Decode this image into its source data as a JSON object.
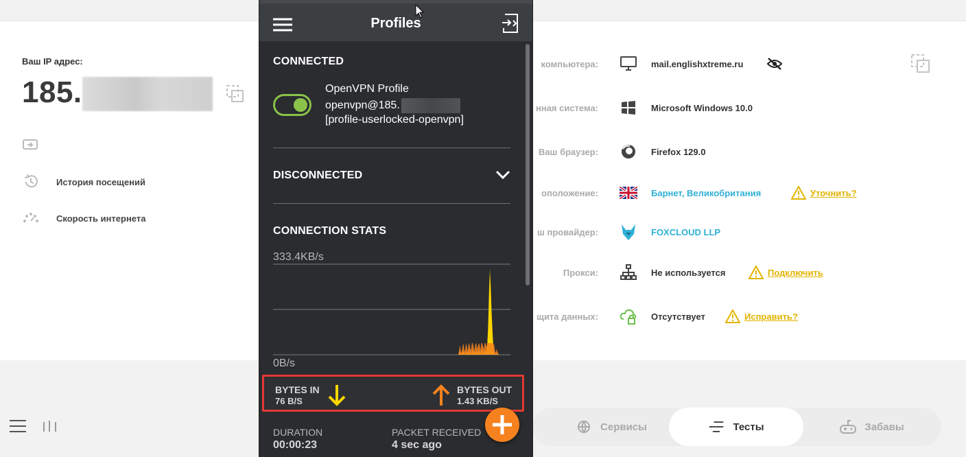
{
  "background_page": {
    "ip_label": "Ваш IP адрес:",
    "ip_prefix": "185.",
    "left_menu": [
      {
        "label": "История посещений",
        "icon": "history-icon"
      },
      {
        "label": "Скорость интернета",
        "icon": "speedometer-icon"
      }
    ],
    "info_rows": [
      {
        "key": "компьютера:",
        "icon": "monitor-icon",
        "value": "mail.englishxtreme.ru"
      },
      {
        "key": "нная система:",
        "icon": "windows-icon",
        "value": "Microsoft Windows 10.0"
      },
      {
        "key": "Ваш браузер:",
        "icon": "firefox-icon",
        "value": "Firefox 129.0"
      },
      {
        "key": "оположение:",
        "icon": "uk-flag-icon",
        "value": "Барнет, Великобритания",
        "warn_label": "Уточнить?"
      },
      {
        "key": "ш провайдер:",
        "icon": "foxcloud-icon",
        "value": "FOXCLOUD LLP"
      },
      {
        "key": "Прокси:",
        "icon": "network-icon",
        "value": "Не используется",
        "warn_label": "Подключить"
      },
      {
        "key": "щита данных:",
        "icon": "cloud-lock-icon",
        "value": "Отсутствует",
        "warn_label": "Исправить?"
      }
    ],
    "bottom_tabs": [
      {
        "label": "Сервисы",
        "icon": "globe-icon"
      },
      {
        "label": "Тесты",
        "icon": "tests-icon",
        "active": true
      },
      {
        "label": "Забавы",
        "icon": "gamepad-icon"
      }
    ]
  },
  "vpn": {
    "title": "Profiles",
    "connected_title": "CONNECTED",
    "profile_name": "OpenVPN Profile",
    "profile_user": "openvpn@185.",
    "profile_lock": "[profile-userlocked-openvpn]",
    "toggle_on": true,
    "disconnected_title": "DISCONNECTED",
    "stats_title": "CONNECTION STATS",
    "bytes_in_label": "BYTES IN",
    "bytes_in_value": "76 B/S",
    "bytes_out_label": "BYTES OUT",
    "bytes_out_value": "1.43 KB/S",
    "duration_label": "DURATION",
    "duration_value": "00:00:23",
    "packet_label": "PACKET RECEIVED",
    "packet_value": "4 sec ago"
  },
  "colors": {
    "panel_bg": "#2a2c2f",
    "header_bg": "#3c3f42",
    "toggle_green": "#8bc34a",
    "chart_yellow": "#ffd600",
    "chart_orange": "#f5821f",
    "highlight_red": "#e53935",
    "link_blue": "#2fb0d6",
    "warn_yellow": "#e2b400"
  },
  "chart_data": {
    "type": "area",
    "ylabel_top": "333.4KB/s",
    "ylabel_bottom": "0B/s",
    "ylim": [
      0,
      333.4
    ],
    "series": [
      {
        "values": [
          0,
          0,
          0,
          0,
          0,
          0,
          0,
          0,
          0,
          0,
          0,
          0,
          0,
          0,
          0,
          0,
          0,
          0,
          0,
          0,
          0,
          0,
          0,
          0,
          0,
          0,
          0,
          0,
          0,
          0,
          0,
          0,
          0,
          0,
          0,
          0,
          0,
          0,
          0,
          0,
          0,
          0,
          0,
          0,
          0,
          0,
          0,
          0,
          0,
          0,
          0,
          0,
          0,
          0,
          0,
          0,
          0,
          0,
          0,
          0,
          0,
          0,
          0,
          0,
          0,
          0,
          0,
          0,
          0,
          0,
          0,
          0,
          0,
          0,
          0,
          0,
          0,
          0,
          0,
          0,
          0,
          0,
          0,
          0,
          0,
          0,
          0,
          0,
          0,
          0,
          0,
          0,
          0,
          0,
          0,
          0,
          0,
          0,
          0,
          0,
          0,
          0,
          0,
          0,
          0,
          0,
          0,
          0,
          0,
          0,
          0,
          0,
          0,
          0,
          0,
          0,
          0,
          0,
          0,
          0,
          0,
          0,
          0,
          0,
          0,
          0,
          0,
          0,
          0,
          0,
          0,
          0,
          0,
          0,
          0,
          0,
          0,
          0,
          0,
          0,
          0,
          0,
          0,
          0,
          0,
          0,
          0,
          0,
          0,
          0,
          0,
          0,
          0,
          0,
          0,
          0,
          0,
          0,
          0,
          0,
          0,
          0,
          0,
          0,
          0,
          0,
          0,
          0,
          0,
          0,
          0,
          0,
          0,
          0,
          0,
          0,
          0,
          0,
          0,
          0,
          0,
          0,
          0,
          0,
          0,
          0,
          0,
          0,
          0,
          0,
          0,
          0,
          0,
          0,
          0,
          0,
          0,
          0,
          0,
          0,
          0,
          0,
          0,
          0,
          0,
          0,
          0,
          0,
          0,
          0,
          0,
          0,
          0,
          0,
          0,
          0,
          0,
          4,
          10,
          5,
          2,
          8,
          14,
          6,
          3,
          12,
          9,
          4,
          10,
          16,
          7,
          5,
          12,
          20,
          8,
          4,
          11,
          15,
          6,
          9,
          18,
          10,
          5,
          12,
          22,
          9,
          6,
          14,
          20,
          8,
          40,
          110,
          230,
          318,
          250,
          160,
          90,
          30,
          10,
          4,
          2,
          6,
          3,
          1,
          0,
          0,
          0,
          0,
          0,
          0,
          0,
          0,
          0,
          0,
          0,
          0,
          0,
          0
        ]
      }
    ]
  }
}
